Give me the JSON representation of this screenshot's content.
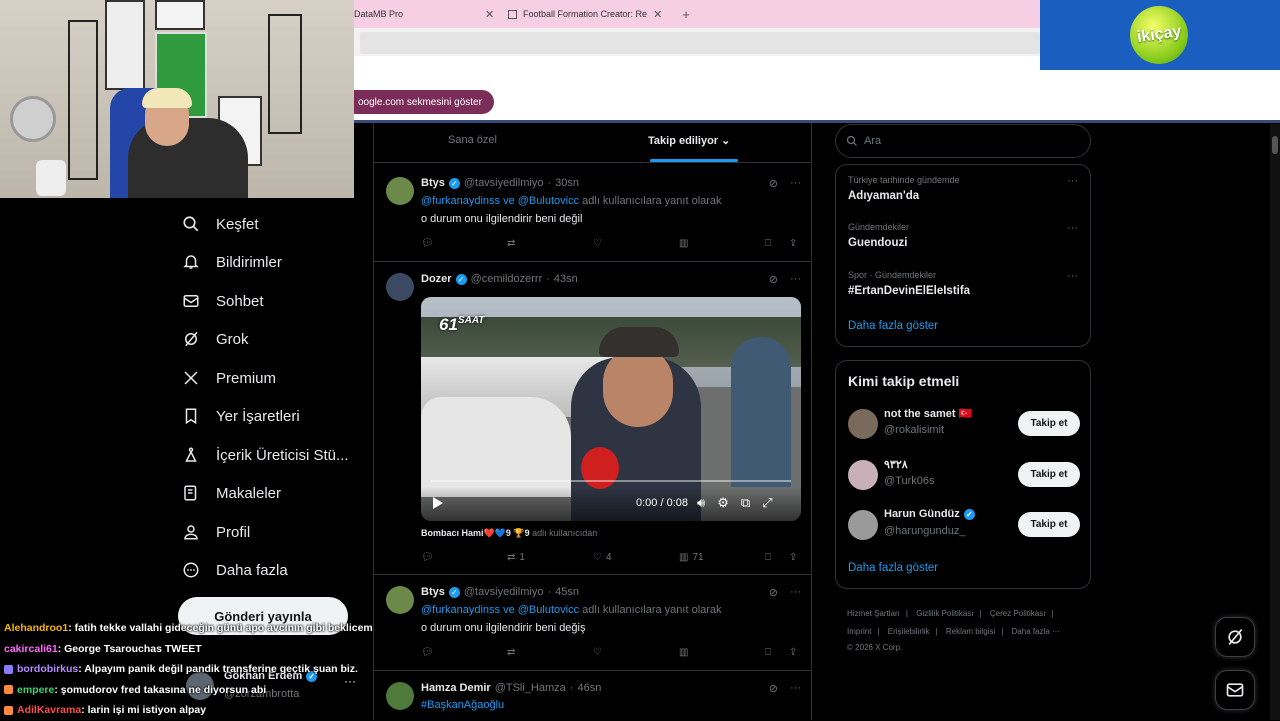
{
  "browser": {
    "tabs": [
      {
        "label": "DataMB Pro"
      },
      {
        "label": "Football Formation Creator: Re"
      }
    ],
    "restore_pill": "oogle.com sekmesini göster",
    "logo_text": "ikiçay"
  },
  "nav": {
    "items": [
      {
        "label": "Keşfet",
        "icon": "search-icon"
      },
      {
        "label": "Bildirimler",
        "icon": "bell-icon"
      },
      {
        "label": "Sohbet",
        "icon": "mail-icon"
      },
      {
        "label": "Grok",
        "icon": "grok-icon"
      },
      {
        "label": "Premium",
        "icon": "x-logo-icon"
      },
      {
        "label": "Yer İşaretleri",
        "icon": "bookmark-icon"
      },
      {
        "label": "İçerik Üreticisi Stü...",
        "icon": "creator-icon"
      },
      {
        "label": "Makaleler",
        "icon": "article-icon"
      },
      {
        "label": "Profil",
        "icon": "person-icon"
      },
      {
        "label": "Daha fazla",
        "icon": "more-circle-icon"
      }
    ],
    "post_button": "Gönderi yayınla",
    "account": {
      "name": "Gökhan Erdem",
      "handle": "@zorzambrotta"
    }
  },
  "chat": [
    {
      "user": "Alehandroo1",
      "color": "#f4b400",
      "text": ": fatih tekke vallahi gideceğin günü apo avcının gibi beklicem"
    },
    {
      "user": "cakircali61",
      "color": "#ff6bff",
      "text": ": George Tsarouchas TWEET"
    },
    {
      "user": "bordobirkus",
      "color": "#b48cff",
      "text": ": Alpayım panik değil pandik transferine geçtik şuan biz."
    },
    {
      "user": "empere",
      "color": "#3ed16f",
      "text": ": şomudorov fred takasına ne diyorsun abi"
    },
    {
      "user": "AdilKavrama",
      "color": "#ff4d4d",
      "text": ": larin işi mi istiyon alpay"
    }
  ],
  "feed": {
    "tabs": [
      "Sana özel",
      "Takip ediliyor"
    ],
    "tweets": [
      {
        "name": "Btys",
        "handle": "@tavsiyedilmiyo",
        "time": "30sn",
        "reply_links": "@furkanaydinss ve @Bulutovicc",
        "reply_suffix": "adlı kullanıcılara yanıt olarak",
        "text": "o durum onu ilgilendirir beni değil",
        "retweets": "",
        "likes": "",
        "views": ""
      },
      {
        "name": "Dozer",
        "handle": "@cemildozerrr",
        "time": "43sn",
        "video_time": "0:00 / 0:08",
        "video_logo": "61",
        "video_logo_sub": "SAAT",
        "tagline": "Bombacı Hami❤️💙9 🏆9",
        "tagline_suffix": "adlı kullanıcıdan",
        "retweets": "1",
        "likes": "4",
        "views": "71"
      },
      {
        "name": "Btys",
        "handle": "@tavsiyedilmiyo",
        "time": "45sn",
        "reply_links": "@furkanaydinss ve @Bulutovicc",
        "reply_suffix": "adlı kullanıcılara yanıt olarak",
        "text": "o durum onu ilgilendirir beni değiş",
        "retweets": "",
        "likes": "",
        "views": ""
      },
      {
        "name": "Hamza Demir",
        "handle": "@TSli_Hamza",
        "time": "46sn",
        "text": "#BaşkanAğaoğlu"
      }
    ]
  },
  "right": {
    "search_placeholder": "Ara",
    "trends": [
      {
        "category": "Türkiye tarihinde gündemde",
        "title": "Adıyaman'da"
      },
      {
        "category": "Gündemdekiler",
        "title": "Guendouzi"
      },
      {
        "category": "Spor · Gündemdekiler",
        "title": "#ErtanDevinElEleIstifa"
      }
    ],
    "trends_more": "Daha fazla göster",
    "follow_title": "Kimi takip etmeli",
    "follow": [
      {
        "name": "not the samet 🇹🇷",
        "handle": "@rokalisimit",
        "button": "Takip et",
        "verified": false
      },
      {
        "name": "٩٣٢٨",
        "handle": "@Turk06s",
        "button": "Takip et",
        "verified": false
      },
      {
        "name": "Harun Gündüz",
        "handle": "@harungunduz_",
        "button": "Takip et",
        "verified": true
      }
    ],
    "follow_more": "Daha fazla göster",
    "footer": {
      "row1": [
        "Hizmet Şartları",
        "Gizlilik Politikası",
        "Çerez Politikası"
      ],
      "row2": [
        "Imprint",
        "Erişilebilirlik",
        "Reklam bilgisi",
        "Daha fazla ···"
      ],
      "copyright": "© 2026 X Corp."
    }
  }
}
